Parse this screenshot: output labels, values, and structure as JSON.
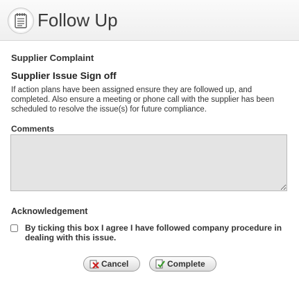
{
  "header": {
    "title": "Follow Up",
    "icon": "notepad-icon"
  },
  "form": {
    "section_title": "Supplier Complaint",
    "subheading": "Supplier Issue Sign off",
    "description": "If action plans have been assigned ensure they are followed up, and completed. Also ensure a meeting or phone call with the supplier has been scheduled to resolve the issue(s) for future compliance.",
    "comments_label": "Comments",
    "comments_value": "",
    "acknowledgement_label": "Acknowledgement",
    "acknowledgement_text": "By ticking this box I agree I have followed company procedure in dealing with this issue.",
    "acknowledgement_checked": false
  },
  "buttons": {
    "cancel_label": "Cancel",
    "cancel_icon": "cancel-x-icon",
    "complete_label": "Complete",
    "complete_icon": "document-check-icon"
  },
  "colors": {
    "header_bg": "#efefef",
    "textarea_bg": "#e4e4e4",
    "cancel_icon_color": "#cc1f1f",
    "complete_icon_color": "#3c9a2f"
  }
}
